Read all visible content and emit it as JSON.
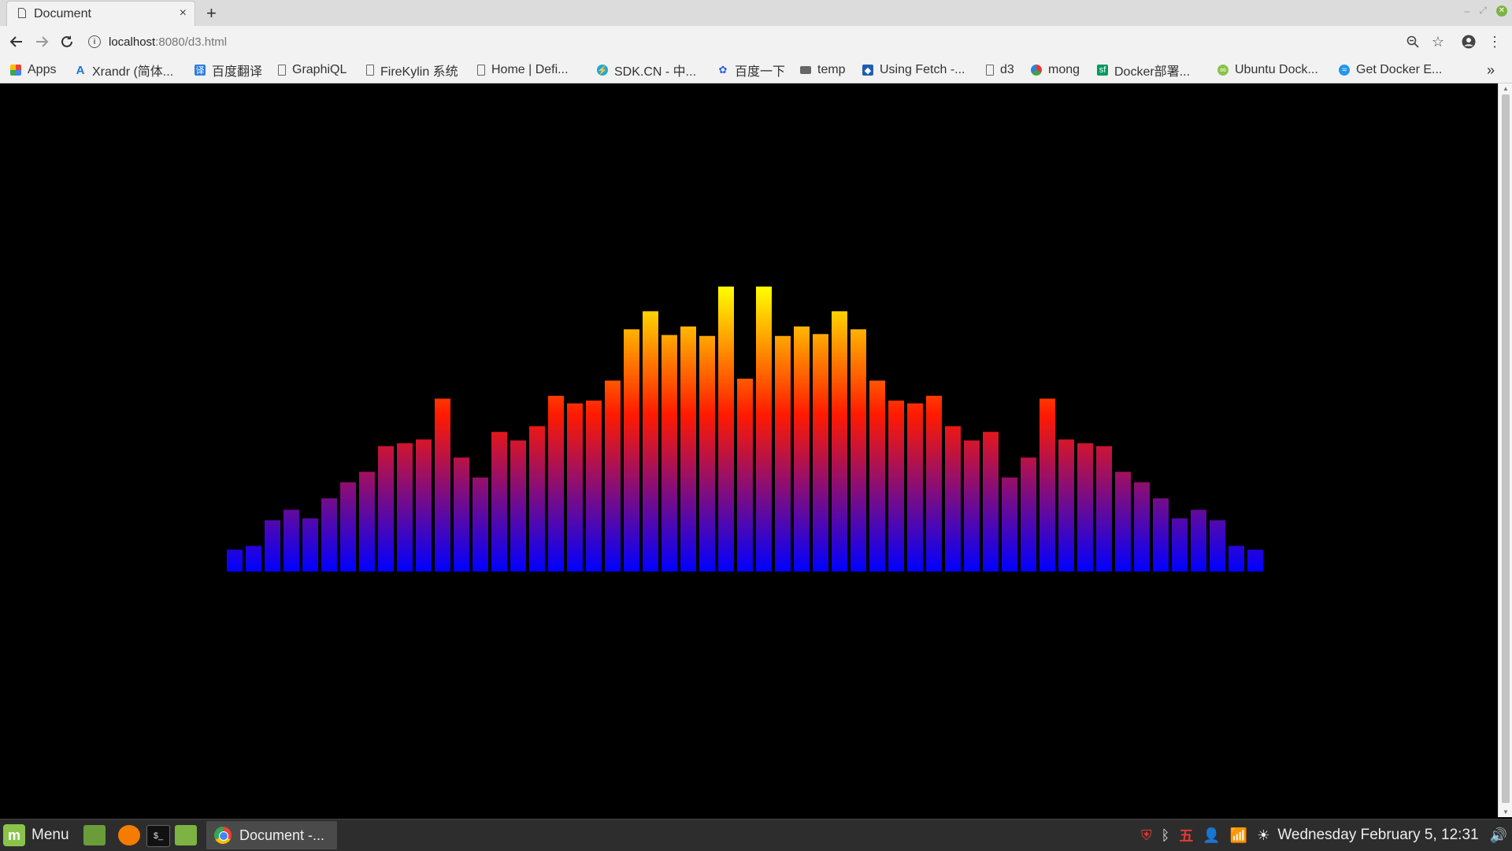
{
  "browser": {
    "tab_title": "Document",
    "tab_close": "×",
    "new_tab": "+",
    "url_host": "localhost",
    "url_path": ":8080/d3.html"
  },
  "bookmarks": [
    {
      "label": "Apps",
      "icon": "apps-grid-icon"
    },
    {
      "label": "Xrandr (简体...",
      "icon": "xrandr-icon"
    },
    {
      "label": "百度翻译",
      "icon": "baidu-translate-icon"
    },
    {
      "label": "GraphiQL",
      "icon": "page-icon"
    },
    {
      "label": "FireKylin 系统",
      "icon": "page-icon"
    },
    {
      "label": "Home | Defi...",
      "icon": "page-icon"
    },
    {
      "label": "SDK.CN - 中...",
      "icon": "sdk-icon"
    },
    {
      "label": "百度一下",
      "icon": "baidu-paw-icon"
    },
    {
      "label": "temp",
      "icon": "folder-icon"
    },
    {
      "label": "Using Fetch -...",
      "icon": "mdn-icon"
    },
    {
      "label": "d3",
      "icon": "page-icon"
    },
    {
      "label": "mong",
      "icon": "mong-icon"
    },
    {
      "label": "Docker部署...",
      "icon": "segmentfault-icon"
    },
    {
      "label": "Ubuntu Dock...",
      "icon": "ubuntu-dock-icon"
    },
    {
      "label": "Get Docker E...",
      "icon": "docker-icon"
    }
  ],
  "bookmarks_overflow": "»",
  "chart_data": {
    "type": "bar",
    "title": "",
    "xlabel": "",
    "ylabel": "",
    "ylim": [
      0,
      300
    ],
    "grid": false,
    "color_gradient": {
      "low": "#0000ff",
      "mid": "#ff1a00",
      "high": "#ffff00"
    },
    "values": [
      23,
      27,
      54,
      65,
      56,
      77,
      94,
      105,
      132,
      135,
      139,
      182,
      120,
      99,
      147,
      138,
      153,
      185,
      177,
      180,
      201,
      255,
      274,
      249,
      258,
      248,
      300,
      203,
      300,
      248,
      258,
      250,
      274,
      255,
      201,
      180,
      177,
      185,
      153,
      138,
      147,
      99,
      120,
      182,
      139,
      135,
      132,
      105,
      94,
      77,
      56,
      65,
      54,
      27,
      23
    ]
  },
  "taskbar": {
    "menu_label": "Menu",
    "window_label": "Document -...",
    "clock": "Wednesday February  5, 12:31"
  }
}
